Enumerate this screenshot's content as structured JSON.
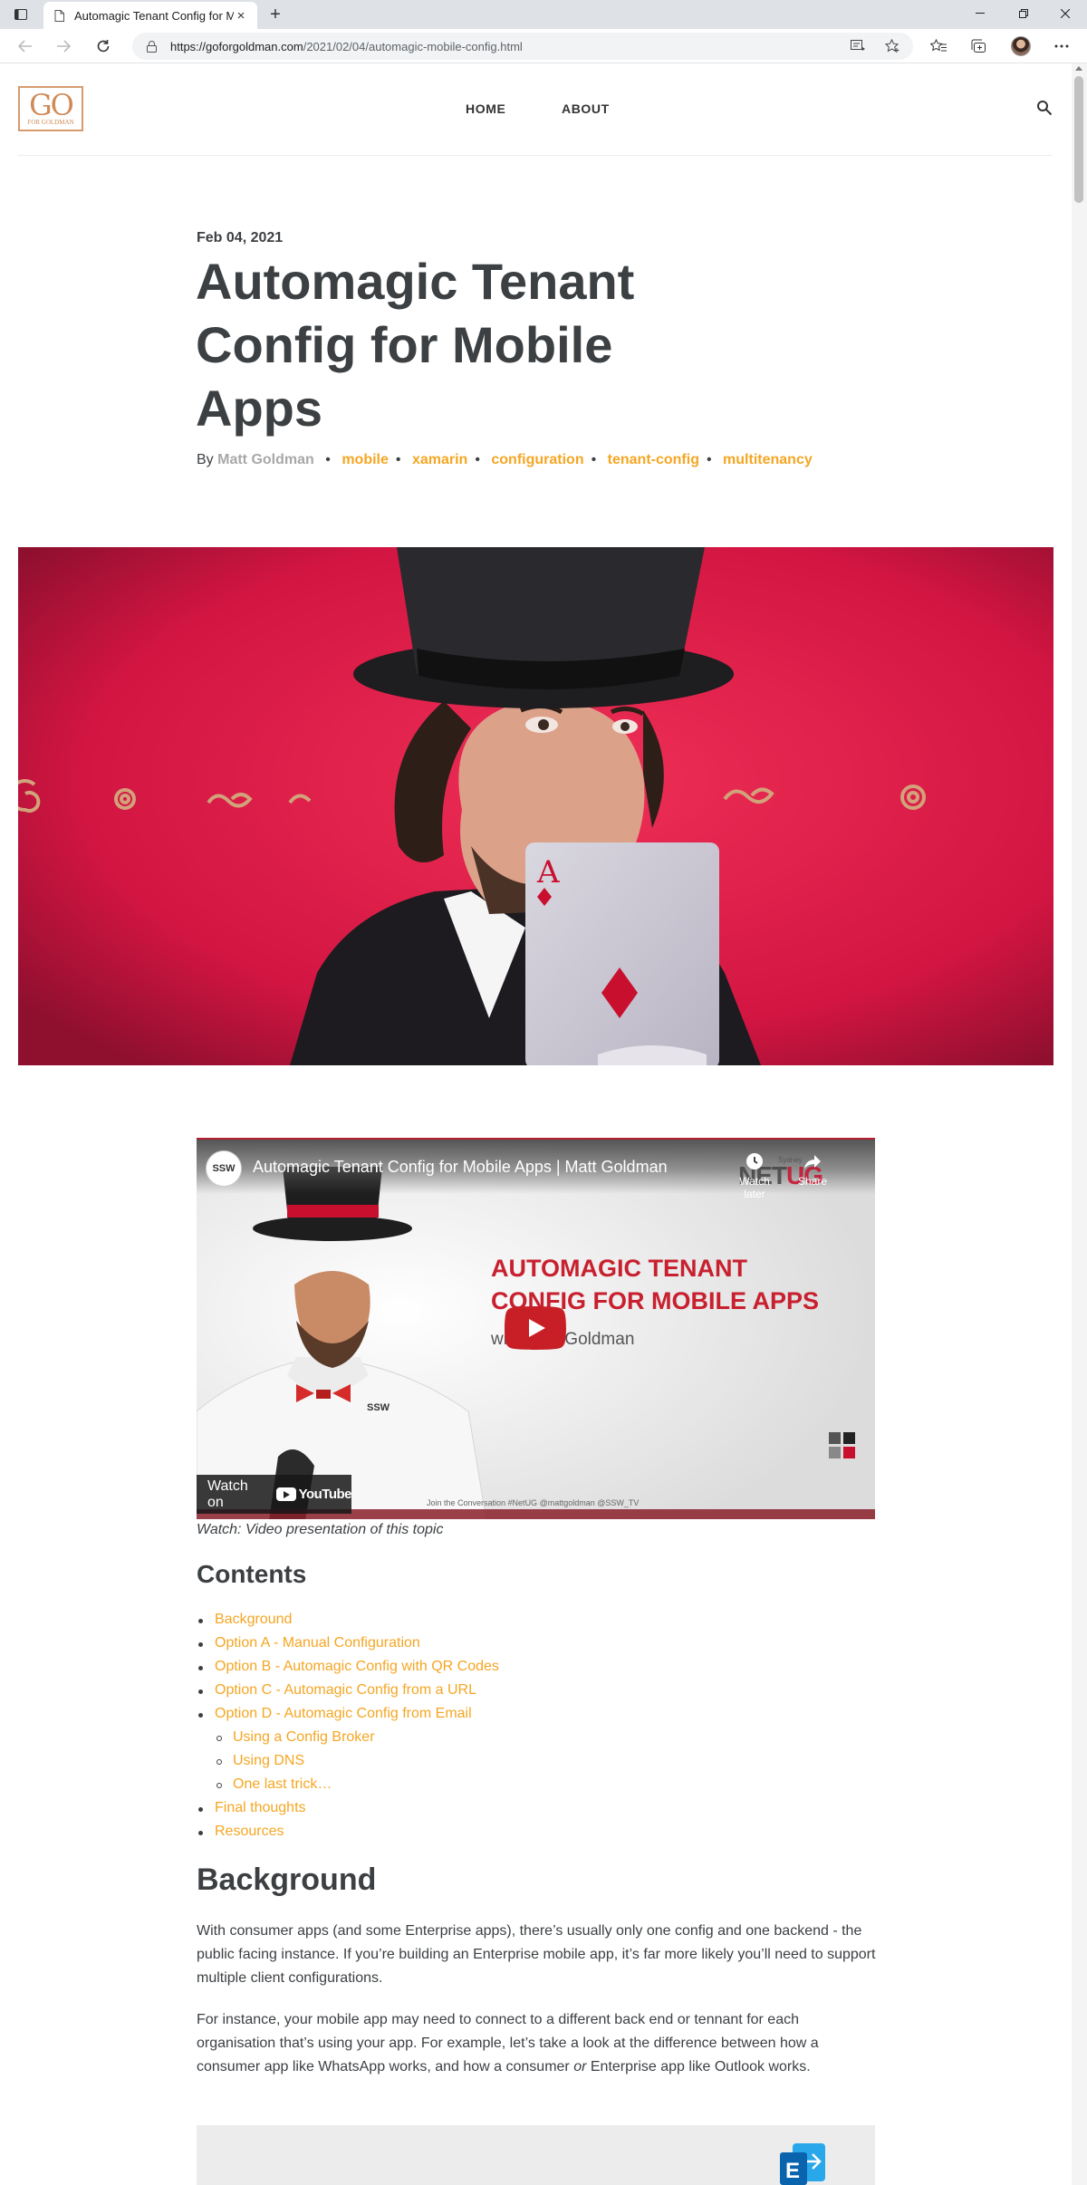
{
  "browser": {
    "tab_title": "Automagic Tenant Config for Mo",
    "url_host": "https://goforgoldman.com",
    "url_path": "/2021/02/04/automagic-mobile-config.html",
    "new_tab_symbol": "+",
    "close_symbol": "×"
  },
  "site": {
    "logo_main": "GO",
    "logo_sub": "FOR GOLDMAN",
    "nav": {
      "home": "HOME",
      "about": "ABOUT"
    },
    "accent_color": "#f5a623"
  },
  "post": {
    "date": "Feb 04, 2021",
    "title": "Automagic Tenant Config for Mobile Apps",
    "by_label": "By",
    "author": "Matt Goldman",
    "tags": [
      "mobile",
      "xamarin",
      "configuration",
      "tenant-config",
      "multitenancy"
    ]
  },
  "video": {
    "channel_badge": "SSW",
    "title": "Automagic Tenant Config for Mobile Apps | Matt Goldman",
    "watch_later": "Watch later",
    "share": "Share",
    "brand_a": "NET",
    "brand_b": "UG",
    "brand_small": "Sydney",
    "headline_1": "AUTOMAGIC TENANT",
    "headline_2": "CONFIG FOR MOBILE APPS",
    "subline": "with Matt Goldman",
    "watch_on": "Watch on",
    "youtube": "YouTube",
    "join_line": "Join the Conversation  #NetUG @mattgoldman @SSW_TV",
    "shirt_logo": "SSW"
  },
  "caption": "Watch: Video presentation of this topic",
  "contents": {
    "heading": "Contents",
    "items": [
      "Background",
      "Option A - Manual Configuration",
      "Option B - Automagic Config with QR Codes",
      "Option C - Automagic Config from a URL",
      "Option D - Automagic Config from Email"
    ],
    "subitems": [
      "Using a Config Broker",
      "Using DNS",
      "One last trick…"
    ],
    "tail_items": [
      "Final thoughts",
      "Resources"
    ]
  },
  "background": {
    "heading": "Background",
    "p1": "With consumer apps (and some Enterprise apps), there’s usually only one config and one backend - the public facing instance. If you’re building an Enterprise mobile app, it’s far more likely you’ll need to support multiple client configurations.",
    "p2_a": "For instance, your mobile app may need to connect to a different back end or tennant for each organisation that’s using your app. For example, let’s take a look at the difference between how a consumer app like WhatsApp works, and how a consumer ",
    "p2_em": "or",
    "p2_b": " Enterprise app like Outlook works."
  }
}
